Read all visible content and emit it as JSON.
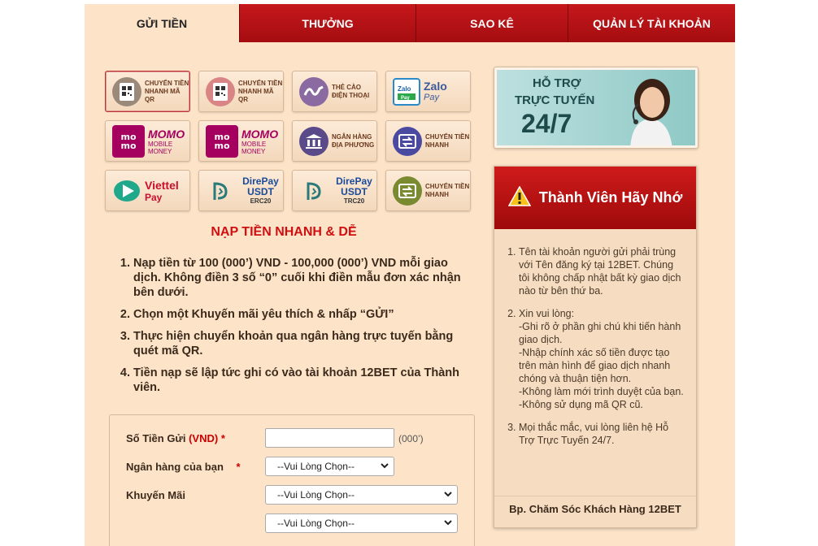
{
  "tabs": [
    {
      "label": "GỬI TIỀN",
      "active": true
    },
    {
      "label": "THƯỞNG",
      "active": false
    },
    {
      "label": "SAO KÊ",
      "active": false
    },
    {
      "label": "QUẢN LÝ TÀI KHOẢN",
      "active": false
    }
  ],
  "payments": [
    {
      "label": "CHUYỂN TIỀN NHANH MÃ QR",
      "icon": "qr-icon"
    },
    {
      "label": "CHUYỂN TIỀN NHANH MÃ QR",
      "icon": "qr-icon"
    },
    {
      "label": "THẺ CÀO ĐIỆN THOẠI",
      "icon": "phone-card-icon"
    },
    {
      "label": "Zalo",
      "sub": "Pay",
      "icon": "zalo-pay-icon"
    },
    {
      "label": "MOMO",
      "sub": "MOBILE MONEY",
      "icon": "momo-icon"
    },
    {
      "label": "MOMO",
      "sub": "MOBILE MONEY",
      "icon": "momo-icon"
    },
    {
      "label": "NGÂN HÀNG ĐỊA PHƯƠNG",
      "icon": "bank-icon"
    },
    {
      "label": "CHUYỂN TIỀN NHANH",
      "icon": "fast-transfer-icon"
    },
    {
      "label": "Viettel",
      "sub": "Pay",
      "icon": "viettel-pay-icon"
    },
    {
      "label": "DirePay USDT",
      "sub": "ERC20",
      "icon": "direpay-icon"
    },
    {
      "label": "DirePay USDT",
      "sub": "TRC20",
      "icon": "direpay-icon"
    },
    {
      "label": "CHUYỂN TIỀN NHANH",
      "icon": "fast-transfer-icon"
    }
  ],
  "main": {
    "title": "NẠP TIỀN NHANH & DỄ",
    "steps": [
      "Nạp tiền từ 100 (000’) VND - 100,000 (000’) VND mỗi giao dịch. Không điền 3 số “0” cuối khi điền mẫu đơn xác nhận bên dưới.",
      "Chọn một Khuyến mãi yêu thích & nhấp “GỬI”",
      "Thực hiện chuyển khoản qua ngân hàng trực tuyến bằng quét mã QR.",
      "Tiền nạp sẽ lập tức ghi có vào tài khoản 12BET của Thành viên."
    ]
  },
  "form": {
    "amount_label": "Số Tiền Gửi",
    "amount_currency": "(VND)",
    "required_mark": "*",
    "amount_unit": "(000’)",
    "bank_label": "Ngân hàng của bạn",
    "promo_label": "Khuyến Mãi",
    "select_placeholder": "--Vui Lòng Chọn--"
  },
  "support": {
    "line1": "HỖ TRỢ",
    "line2": "TRỰC TUYẾN",
    "line3": "24/7"
  },
  "notice": {
    "title": "Thành Viên Hãy Nhớ",
    "items": [
      "Tên tài khoản người gửi phải trùng với Tên đăng ký tại 12BET. Chúng tôi không chấp nhật bất kỳ giao dịch nào từ bên thứ ba.",
      "Xin vui lòng:\n-Ghi rõ ở phần ghi chú khi tiến hành giao dịch.\n-Nhập chính xác số tiền được tạo trên màn hình để giao dịch nhanh chóng và thuận tiện hơn.\n-Không làm mới trình duyệt của bạn.\n-Không sử dụng mã QR cũ.",
      "Mọi thắc mắc, vui lòng liên hệ Hỗ Trợ Trực Tuyến 24/7."
    ],
    "footer": "Bp. Chăm Sóc Khách Hàng 12BET"
  },
  "colors": {
    "tab_red": "#b81216",
    "page_bg": "#fde4c9",
    "title_red": "#d01010"
  }
}
